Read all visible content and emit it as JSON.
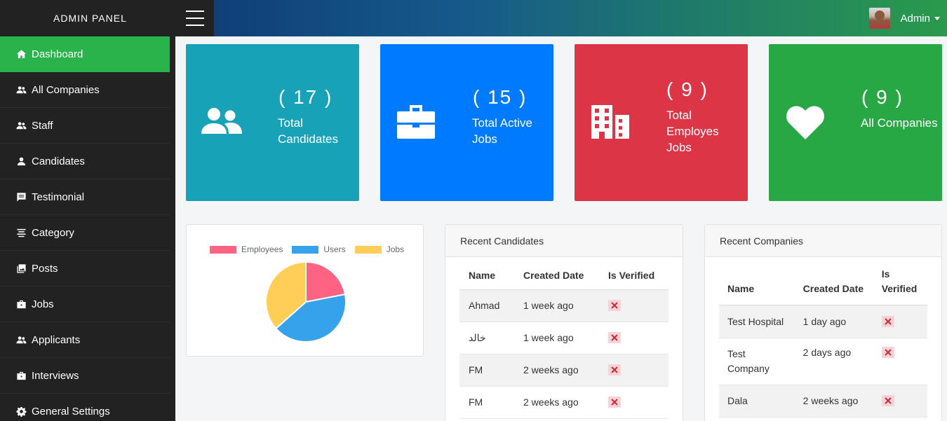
{
  "header": {
    "brand": "ADMIN PANEL",
    "user_name": "Admin"
  },
  "sidebar": {
    "items": [
      {
        "label": "Dashboard",
        "icon": "home-icon",
        "active": true
      },
      {
        "label": "All Companies",
        "icon": "people-icon"
      },
      {
        "label": "Staff",
        "icon": "people-icon"
      },
      {
        "label": "Candidates",
        "icon": "person-icon"
      },
      {
        "label": "Testimonial",
        "icon": "comment-icon"
      },
      {
        "label": "Category",
        "icon": "align-icon"
      },
      {
        "label": "Posts",
        "icon": "image-icon"
      },
      {
        "label": "Jobs",
        "icon": "briefcase-icon"
      },
      {
        "label": "Applicants",
        "icon": "people-icon"
      },
      {
        "label": "Interviews",
        "icon": "briefcase-icon"
      },
      {
        "label": "General Settings",
        "icon": "gear-icon"
      }
    ]
  },
  "stats": [
    {
      "count": "( 17 )",
      "label": "Total Candidates",
      "icon": "users-icon",
      "color": "#17a2b8"
    },
    {
      "count": "( 15 )",
      "label": "Total Active Jobs",
      "icon": "briefcase-icon",
      "color": "#007bff"
    },
    {
      "count": "( 9 )",
      "label": "Total Employes Jobs",
      "icon": "building-icon",
      "color": "#dc3545"
    },
    {
      "count": "( 9 )",
      "label": "All Companies",
      "icon": "heart-icon",
      "color": "#28a745"
    }
  ],
  "chart_data": {
    "type": "pie",
    "legend_position": "top",
    "series": [
      {
        "name": "Employees",
        "value": 9,
        "color": "#ff6384"
      },
      {
        "name": "Users",
        "value": 17,
        "color": "#36a2eb"
      },
      {
        "name": "Jobs",
        "value": 15,
        "color": "#ffce56"
      }
    ]
  },
  "recent_candidates": {
    "title": "Recent Candidates",
    "columns": [
      "Name",
      "Created Date",
      "Is Verified"
    ],
    "rows": [
      {
        "name": "Ahmad",
        "date": "1 week ago",
        "verified": false
      },
      {
        "name": "خالد",
        "date": "1 week ago",
        "verified": false
      },
      {
        "name": "FM",
        "date": "2 weeks ago",
        "verified": false
      },
      {
        "name": "FM",
        "date": "2 weeks ago",
        "verified": false
      }
    ]
  },
  "recent_companies": {
    "title": "Recent Companies",
    "columns": [
      "Name",
      "Created Date",
      "Is Verified"
    ],
    "rows": [
      {
        "name": "Test Hospital",
        "date": "1 day ago",
        "verified": false
      },
      {
        "name": "Test Company",
        "date": "2 days ago",
        "verified": false
      },
      {
        "name": "Dala",
        "date": "2 weeks ago",
        "verified": false
      }
    ]
  },
  "colors": {
    "sidebar_bg": "#222222",
    "active_green": "#29b34a"
  }
}
